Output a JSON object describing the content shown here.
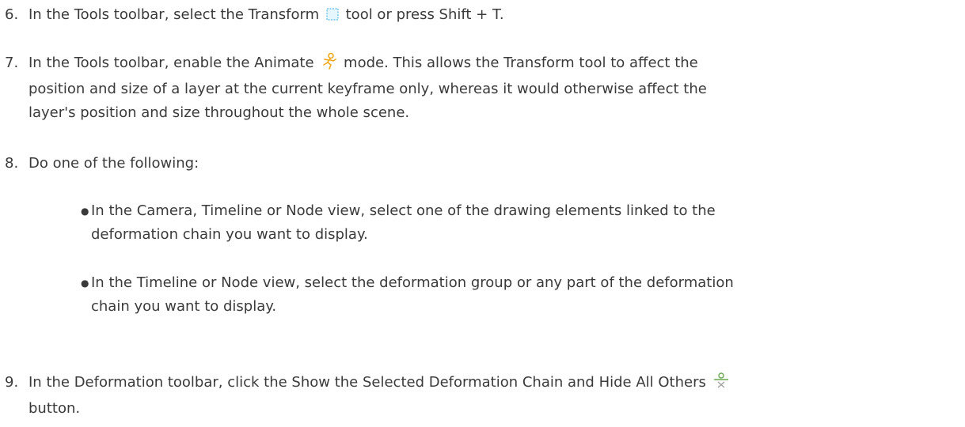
{
  "steps": [
    {
      "number": "6.",
      "lines": [
        "In the Tools toolbar, select the Transform",
        "tool or press Shift + T."
      ],
      "icon": "transform-tool-icon"
    },
    {
      "number": "7.",
      "lines": [
        "In the Tools toolbar, enable the Animate",
        "mode. This allows the Transform tool to affect the",
        "position and size of a layer at the current keyframe only, whereas it would otherwise affect the",
        "layer's position and size throughout the whole scene."
      ],
      "icon": "animate-mode-icon"
    },
    {
      "number": "8.",
      "lines": [
        "Do one of the following:"
      ],
      "bullets": [
        {
          "lines": [
            "In the Camera, Timeline or Node view, select one of the drawing elements linked to the",
            "deformation chain you want to display."
          ]
        },
        {
          "lines": [
            "In the Timeline or Node view, select the deformation group or any part of the deformation",
            "chain you want to display."
          ]
        }
      ]
    },
    {
      "number": "9.",
      "lines": [
        "In the Deformation toolbar, click the Show the Selected Deformation Chain and Hide All Others",
        "button."
      ],
      "icon": "show-selected-deformation-chain-icon"
    }
  ],
  "colors": {
    "text": "#3a3a3a",
    "transform_icon": "#8fd3f0",
    "animate_icon": "#f0a818",
    "deformation_icon": "#6aa84f"
  }
}
